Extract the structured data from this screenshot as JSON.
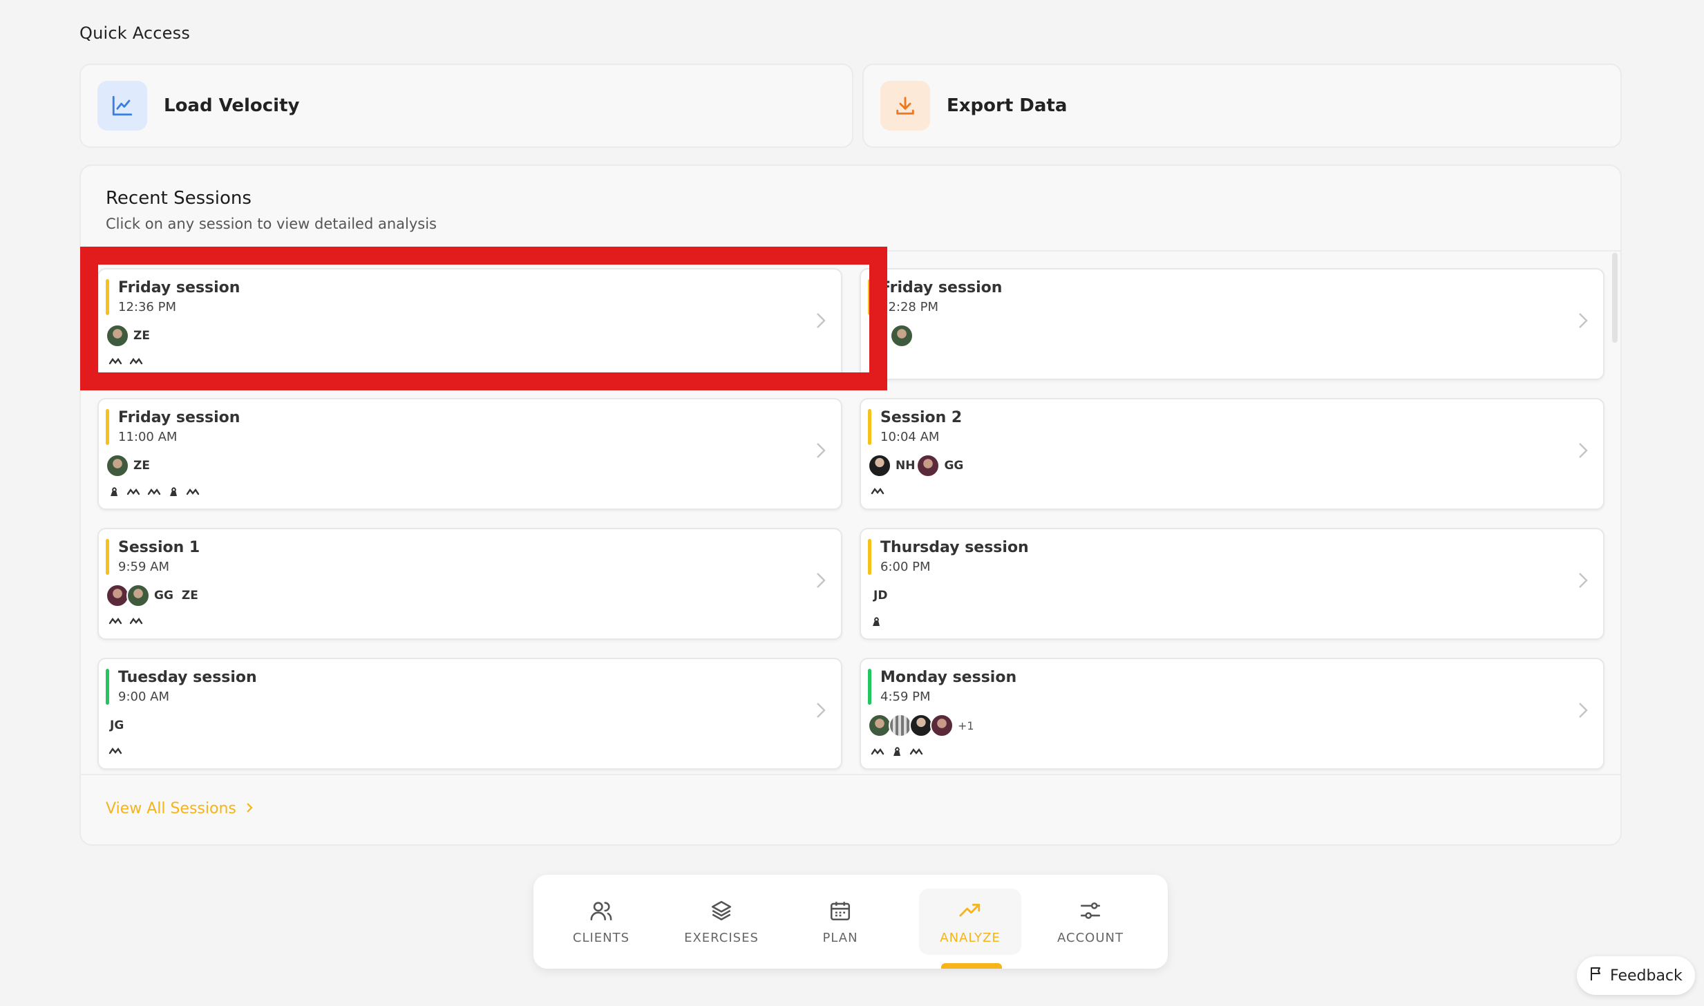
{
  "quick_access": {
    "title": "Quick Access",
    "items": [
      {
        "label": "Load Velocity",
        "icon": "line-chart-icon",
        "color": "#3b7de0",
        "bg": "#dfeafc"
      },
      {
        "label": "Export Data",
        "icon": "download-icon",
        "color": "#f0781a",
        "bg": "#fde9d7"
      }
    ]
  },
  "recent_sessions": {
    "title": "Recent Sessions",
    "subtitle": "Click on any session to view detailed analysis",
    "view_all": "View All Sessions",
    "sessions": [
      {
        "name": "Friday session",
        "time": "12:36 PM",
        "status_color": "#f4c21a",
        "initials": [
          "ZE"
        ],
        "more": ""
      },
      {
        "name": "Friday session",
        "time": "12:28 PM",
        "status_color": "#f4c21a",
        "initials": [],
        "more": ""
      },
      {
        "name": "Friday session",
        "time": "11:00 AM",
        "status_color": "#f4c21a",
        "initials": [
          "ZE"
        ],
        "more": ""
      },
      {
        "name": "Session 2",
        "time": "10:04 AM",
        "status_color": "#f4c21a",
        "initials": [
          "NH",
          "GG"
        ],
        "more": ""
      },
      {
        "name": "Session 1",
        "time": "9:59 AM",
        "status_color": "#f4c21a",
        "initials": [
          "GG",
          "ZE"
        ],
        "more": ""
      },
      {
        "name": "Thursday session",
        "time": "6:00 PM",
        "status_color": "#f4c21a",
        "initials": [
          "JD"
        ],
        "more": ""
      },
      {
        "name": "Tuesday session",
        "time": "9:00 AM",
        "status_color": "#22c55e",
        "initials": [
          "JG"
        ],
        "more": ""
      },
      {
        "name": "Monday session",
        "time": "4:59 PM",
        "status_color": "#22c55e",
        "initials": [],
        "more": "+1"
      }
    ]
  },
  "nav": {
    "items": [
      {
        "label": "CLIENTS",
        "icon": "users-icon"
      },
      {
        "label": "EXERCISES",
        "icon": "layers-icon"
      },
      {
        "label": "PLAN",
        "icon": "calendar-icon"
      },
      {
        "label": "ANALYZE",
        "icon": "trending-up-icon",
        "active": true
      },
      {
        "label": "ACCOUNT",
        "icon": "sliders-icon"
      }
    ]
  },
  "feedback": {
    "label": "Feedback",
    "icon": "flag-icon"
  },
  "colors": {
    "accent": "#f4b41a",
    "highlight": "#e21c1c"
  }
}
